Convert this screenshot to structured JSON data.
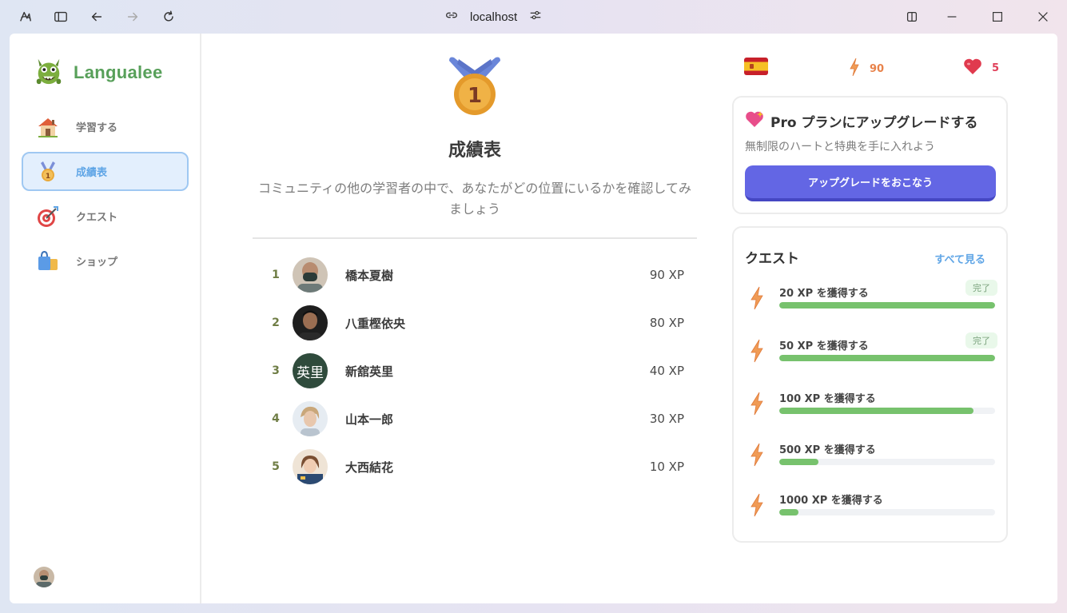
{
  "browser": {
    "url": "localhost"
  },
  "sidebar": {
    "brand": "Langualee",
    "items": [
      {
        "label": "学習する",
        "icon": "house-icon",
        "active": false
      },
      {
        "label": "成績表",
        "icon": "medal-icon",
        "active": true
      },
      {
        "label": "クエスト",
        "icon": "target-icon",
        "active": false
      },
      {
        "label": "ショップ",
        "icon": "shopping-bag-icon",
        "active": false
      }
    ]
  },
  "leaderboard": {
    "title": "成績表",
    "subtitle": "コミュニティの他の学習者の中で、あなたがどの位置にいるかを確認してみましょう",
    "medal_number": "1",
    "rows": [
      {
        "rank": "1",
        "name": "橋本夏樹",
        "xp": "90 XP",
        "avatar": "photo"
      },
      {
        "rank": "2",
        "name": "八重樫依央",
        "xp": "80 XP",
        "avatar": "photo"
      },
      {
        "rank": "3",
        "name": "新舘英里",
        "xp": "40 XP",
        "avatar": "text",
        "avatar_text": "英里"
      },
      {
        "rank": "4",
        "name": "山本一郎",
        "xp": "30 XP",
        "avatar": "photo"
      },
      {
        "rank": "5",
        "name": "大西結花",
        "xp": "10 XP",
        "avatar": "photo"
      }
    ]
  },
  "stats": {
    "language_flag": "spain-flag-icon",
    "xp_points": "90",
    "hearts": "5",
    "xp_color": "#e8824a",
    "heart_color": "#e0405a"
  },
  "pro_card": {
    "title": "Pro プランにアップグレードする",
    "subtitle": "無制限のハートと特典を手に入れよう",
    "button_label": "アップグレードをおこなう"
  },
  "quests": {
    "title": "クエスト",
    "view_all": "すべて見る",
    "items": [
      {
        "label": "20 XP を獲得する",
        "progress": 1.0,
        "badge": "完了"
      },
      {
        "label": "50 XP を獲得する",
        "progress": 1.0,
        "badge": "完了"
      },
      {
        "label": "100 XP を獲得する",
        "progress": 0.9,
        "badge": ""
      },
      {
        "label": "500 XP を獲得する",
        "progress": 0.18,
        "badge": ""
      },
      {
        "label": "1000 XP を獲得する",
        "progress": 0.09,
        "badge": ""
      }
    ]
  }
}
